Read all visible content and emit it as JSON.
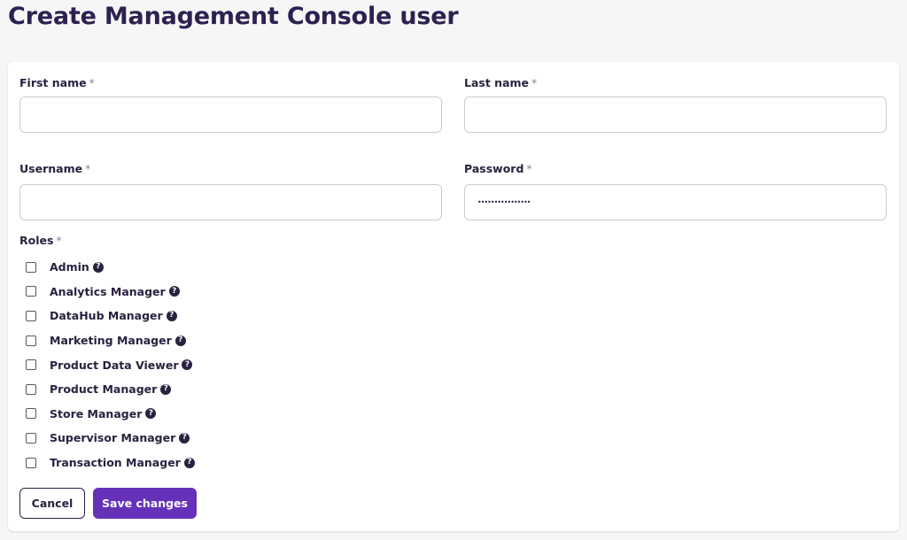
{
  "page": {
    "title": "Create Management Console user"
  },
  "form": {
    "first_name": {
      "label": "First name",
      "required_mark": "*",
      "value": ""
    },
    "last_name": {
      "label": "Last name",
      "required_mark": "*",
      "value": ""
    },
    "username": {
      "label": "Username",
      "required_mark": "*",
      "value": ""
    },
    "password": {
      "label": "Password",
      "required_mark": "*",
      "value": "••••••••••••••••"
    },
    "roles": {
      "label": "Roles",
      "required_mark": "*",
      "help_icon": "question-circle-icon",
      "items": [
        {
          "label": "Admin",
          "checked": false
        },
        {
          "label": "Analytics Manager",
          "checked": false
        },
        {
          "label": "DataHub Manager",
          "checked": false
        },
        {
          "label": "Marketing Manager",
          "checked": false
        },
        {
          "label": "Product Data Viewer",
          "checked": false
        },
        {
          "label": "Product Manager",
          "checked": false
        },
        {
          "label": "Store Manager",
          "checked": false
        },
        {
          "label": "Supervisor Manager",
          "checked": false
        },
        {
          "label": "Transaction Manager",
          "checked": false
        }
      ]
    }
  },
  "actions": {
    "cancel_label": "Cancel",
    "save_label": "Save changes"
  },
  "colors": {
    "primary": "#6531b8",
    "title": "#2d2150",
    "text": "#2a2140",
    "background": "#f6f6f7",
    "card": "#ffffff"
  }
}
